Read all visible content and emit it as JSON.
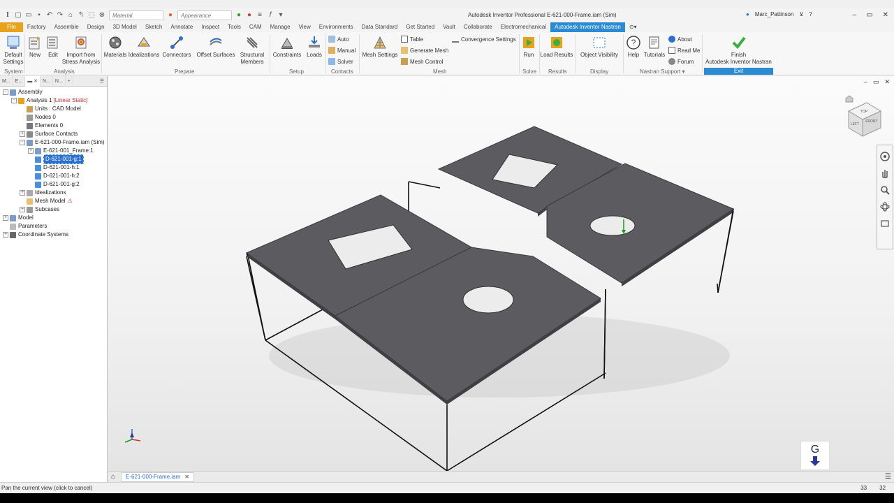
{
  "window": {
    "title": "Autodesk Inventor Professional    E-621-000-Frame.iam (Sim)",
    "user": "Marc_Pattinson"
  },
  "qat": {
    "material_placeholder": "Material",
    "appearance_placeholder": "Appearance"
  },
  "ribbon_tabs": [
    "File",
    "Factory",
    "Assemble",
    "Design",
    "3D Model",
    "Sketch",
    "Annotate",
    "Inspect",
    "Tools",
    "CAM",
    "Manage",
    "View",
    "Environments",
    "Data Standard",
    "Get Started",
    "Vault",
    "Collaborate",
    "Electromechanical",
    "Autodesk Inventor Nastran"
  ],
  "ribbon": {
    "default_settings": "Default\nSettings",
    "new": "New",
    "edit": "Edit",
    "import_stress": "Import from\nStress Analysis",
    "materials": "Materials",
    "idealizations": "Idealizations",
    "connectors": "Connectors",
    "offset_surfaces": "Offset Surfaces",
    "structural_members": "Structural\nMembers",
    "constraints": "Constraints",
    "loads": "Loads",
    "auto": "Auto",
    "manual": "Manual",
    "solver": "Solver",
    "mesh_settings": "Mesh Settings",
    "table": "Table",
    "generate_mesh": "Generate Mesh",
    "mesh_control": "Mesh Control",
    "convergence_settings": "Convergence Settings",
    "run": "Run",
    "load_results": "Load Results",
    "object_visibility": "Object Visibility",
    "help": "Help",
    "tutorials": "Tutorials",
    "about": "About",
    "read_me": "Read Me",
    "forum": "Forum",
    "finish": "Finish\nAutodesk Inventor Nastran",
    "groups": {
      "system": "System",
      "analysis": "Analysis",
      "prepare": "Prepare",
      "setup": "Setup",
      "contacts": "Contacts",
      "mesh": "Mesh",
      "solve": "Solve",
      "results": "Results",
      "display": "Display",
      "nastran_support": "Nastran Support",
      "exit": "Exit"
    }
  },
  "browser": {
    "tabs": [
      "M...",
      "E...",
      "N...",
      "N..."
    ],
    "tree": [
      {
        "label": "Assembly",
        "level": 0,
        "expander": "-",
        "icon": "assembly-icon"
      },
      {
        "label": "Analysis 1",
        "tag": "[Linear Static]",
        "level": 1,
        "expander": "-",
        "icon": "analysis-icon"
      },
      {
        "label": "Units : CAD Model",
        "level": 2,
        "expander": "",
        "icon": "units-icon"
      },
      {
        "label": "Nodes 0",
        "level": 2,
        "expander": "",
        "icon": "nodes-icon"
      },
      {
        "label": "Elements 0",
        "level": 2,
        "expander": "",
        "icon": "elements-icon"
      },
      {
        "label": "Surface Contacts",
        "level": 2,
        "expander": "+",
        "icon": "contacts-icon"
      },
      {
        "label": "E-621-000-Frame.iam (Sim)",
        "level": 2,
        "expander": "-",
        "icon": "assembly-icon"
      },
      {
        "label": "E-621-001_Frame:1",
        "level": 3,
        "expander": "+",
        "icon": "assembly-icon"
      },
      {
        "label": "D-621-001-g:1",
        "level": 3,
        "expander": "",
        "icon": "part-icon",
        "selected": true
      },
      {
        "label": "D-621-001-h:1",
        "level": 3,
        "expander": "",
        "icon": "part-icon"
      },
      {
        "label": "D-621-001-h:2",
        "level": 3,
        "expander": "",
        "icon": "part-icon"
      },
      {
        "label": "D-621-001-g:2",
        "level": 3,
        "expander": "",
        "icon": "part-icon"
      },
      {
        "label": "Idealizations",
        "level": 2,
        "expander": "+",
        "icon": "idealizations-icon"
      },
      {
        "label": "Mesh Model",
        "level": 2,
        "expander": "",
        "icon": "mesh-icon",
        "warning": true
      },
      {
        "label": "Subcases",
        "level": 2,
        "expander": "+",
        "icon": "subcases-icon"
      },
      {
        "label": "Model",
        "level": 0,
        "expander": "+",
        "icon": "model-icon"
      },
      {
        "label": "Parameters",
        "level": 0,
        "expander": "",
        "icon": "parameters-icon"
      },
      {
        "label": "Coordinate Systems",
        "level": 0,
        "expander": "+",
        "icon": "coords-icon"
      }
    ]
  },
  "viewcube": {
    "top": "TOP",
    "left": "LEFT",
    "front": "FRONT"
  },
  "doc_tab": "E-621-000-Frame.iam",
  "status": {
    "text": "Pan the current view (click to cancel)",
    "n1": "33",
    "n2": "32"
  },
  "watermark": "G",
  "colors": {
    "accent": "#2a8bd3",
    "file_tab": "#e8a21c",
    "plate": "#5b5b60",
    "selection": "#2a6fd6"
  }
}
